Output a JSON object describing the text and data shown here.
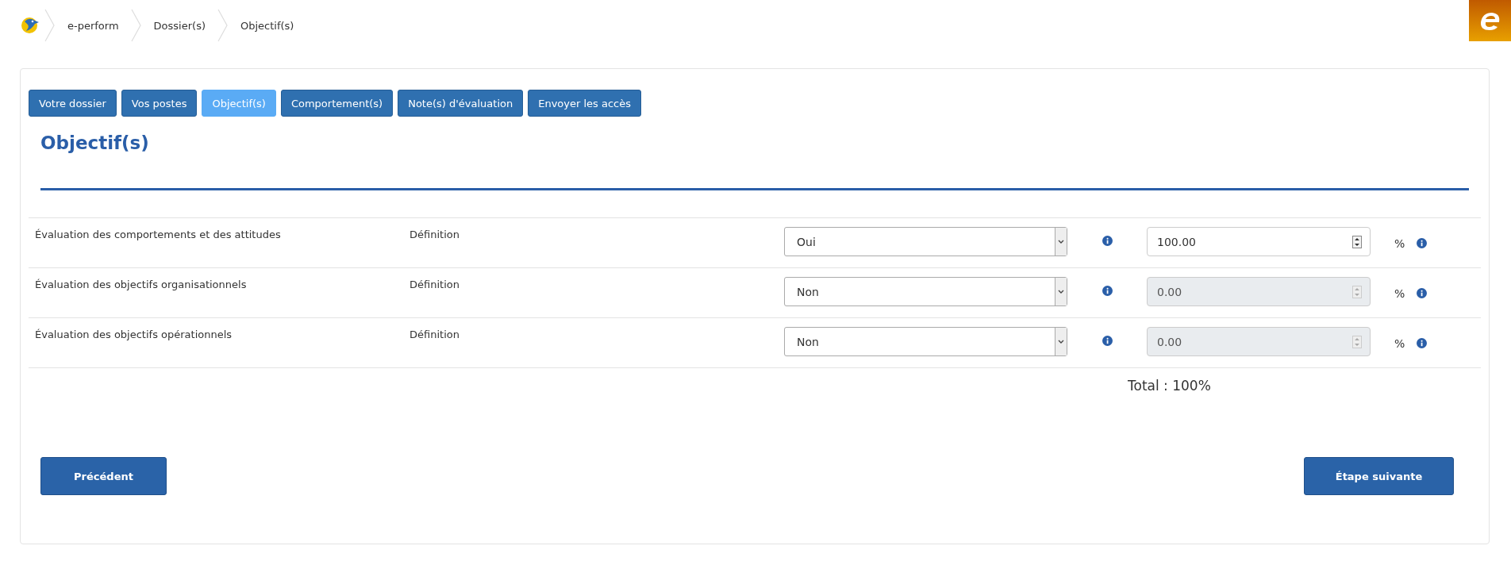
{
  "breadcrumb": [
    "e-perform",
    "Dossier(s)",
    "Objectif(s)"
  ],
  "tabs": [
    {
      "label": "Votre dossier",
      "selected": false
    },
    {
      "label": "Vos postes",
      "selected": false
    },
    {
      "label": "Objectif(s)",
      "selected": true
    },
    {
      "label": "Comportement(s)",
      "selected": false
    },
    {
      "label": "Note(s) d'évaluation",
      "selected": false
    },
    {
      "label": "Envoyer les accès",
      "selected": false
    }
  ],
  "heading": "Objectif(s)",
  "rows": [
    {
      "label": "Évaluation des comportements et des attitudes",
      "link": "Définition",
      "choice": "Oui",
      "percent": "100.00",
      "disabled": false,
      "unit": "%"
    },
    {
      "label": "Évaluation des objectifs organisationnels",
      "link": "Définition",
      "choice": "Non",
      "percent": "0.00",
      "disabled": true,
      "unit": "%"
    },
    {
      "label": "Évaluation des objectifs opérationnels",
      "link": "Définition",
      "choice": "Non",
      "percent": "0.00",
      "disabled": true,
      "unit": "%"
    }
  ],
  "total": "Total : 100%",
  "buttons": {
    "previous": "Précédent",
    "next": "Étape suivante"
  }
}
